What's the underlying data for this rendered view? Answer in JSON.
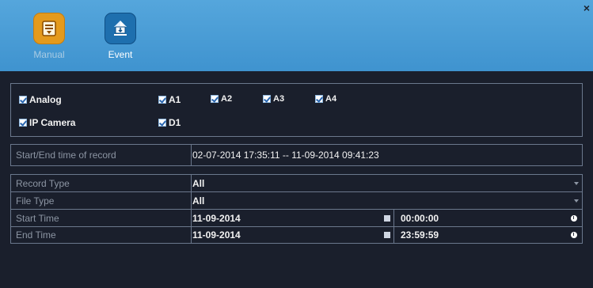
{
  "header": {
    "tabs": [
      {
        "label": "Manual",
        "icon": "manual-record-icon"
      },
      {
        "label": "Event",
        "icon": "event-search-icon"
      }
    ],
    "close": "×"
  },
  "channels": {
    "analog": {
      "label": "Analog",
      "items": [
        "A1",
        "A2",
        "A3",
        "A4"
      ]
    },
    "ip_camera": {
      "label": "IP Camera",
      "items": [
        "D1"
      ]
    }
  },
  "record_range": {
    "label": "Start/End time of record",
    "value": "02-07-2014 17:35:11 -- 11-09-2014 09:41:23"
  },
  "filters": {
    "record_type": {
      "label": "Record Type",
      "value": "All"
    },
    "file_type": {
      "label": "File Type",
      "value": "All"
    },
    "start_time": {
      "label": "Start Time",
      "date": "11-09-2014",
      "time": "00:00:00"
    },
    "end_time": {
      "label": "End Time",
      "date": "11-09-2014",
      "time": "23:59:59"
    }
  },
  "colors": {
    "header": "#4a9fd8",
    "body": "#1a1f2c",
    "border": "#6b788d",
    "muted_label": "#8c95a3"
  }
}
